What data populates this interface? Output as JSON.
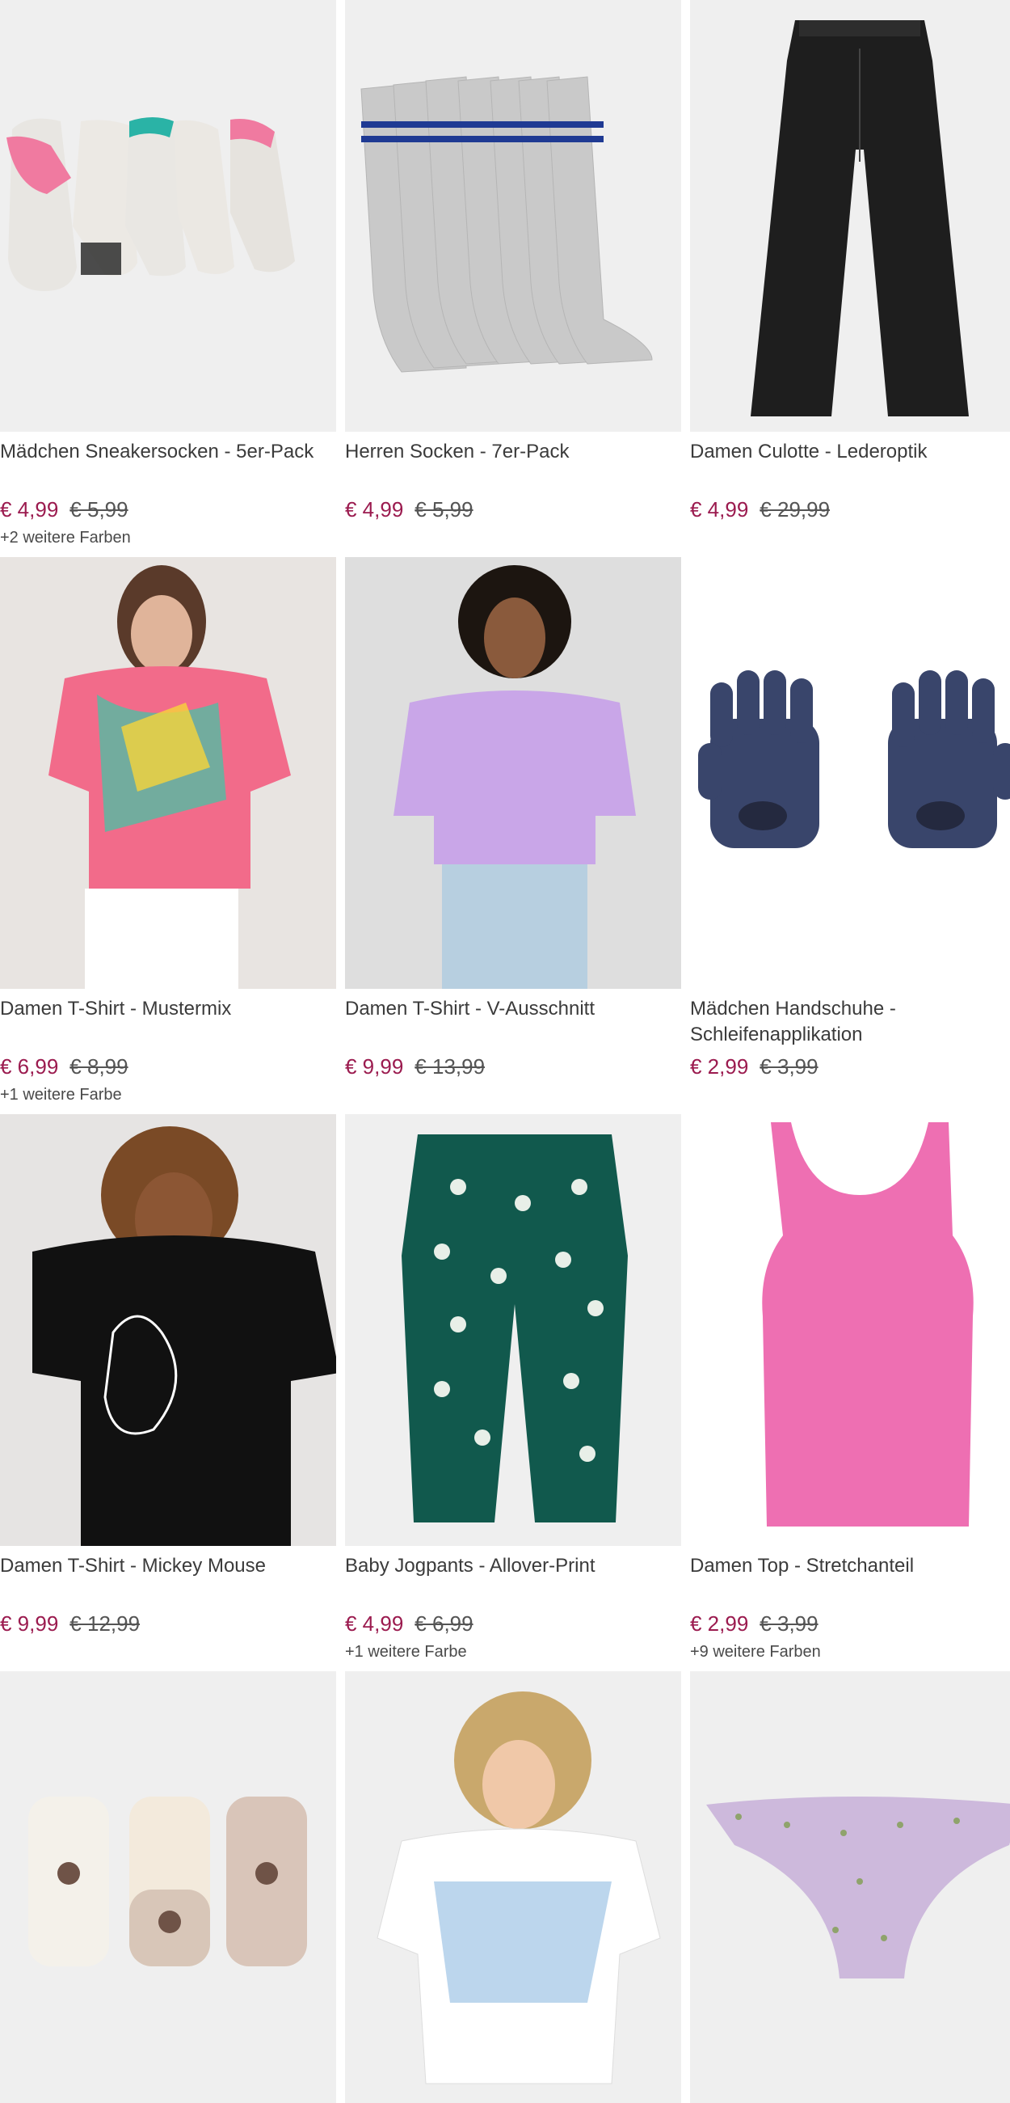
{
  "products": [
    {
      "title": "Mädchen Sneakersocken - 5er-Pack",
      "price": "€ 4,99",
      "old_price": "€ 5,99",
      "colors": "+2 weitere Farben"
    },
    {
      "title": "Herren Socken - 7er-Pack",
      "price": "€ 4,99",
      "old_price": "€ 5,99",
      "colors": ""
    },
    {
      "title": "Damen Culotte - Lederoptik",
      "price": "€ 4,99",
      "old_price": "€ 29,99",
      "colors": ""
    },
    {
      "title": "Damen T-Shirt - Mustermix",
      "price": "€ 6,99",
      "old_price": "€ 8,99",
      "colors": "+1 weitere Farbe"
    },
    {
      "title": "Damen T-Shirt - V-Ausschnitt",
      "price": "€ 9,99",
      "old_price": "€ 13,99",
      "colors": ""
    },
    {
      "title": "Mädchen Handschuhe - Schleifenapplikation",
      "price": "€ 2,99",
      "old_price": "€ 3,99",
      "colors": ""
    },
    {
      "title": "Damen T-Shirt - Mickey Mouse",
      "price": "€ 9,99",
      "old_price": "€ 12,99",
      "colors": ""
    },
    {
      "title": "Baby Jogpants - Allover-Print",
      "price": "€ 4,99",
      "old_price": "€ 6,99",
      "colors": "+1 weitere Farbe"
    },
    {
      "title": "Damen Top - Stretchanteil",
      "price": "€ 2,99",
      "old_price": "€ 3,99",
      "colors": "+9 weitere Farben"
    }
  ],
  "images": [
    {
      "icon": "sneaker-socks-image"
    },
    {
      "icon": "crew-socks-image"
    },
    {
      "icon": "leather-pants-image"
    },
    {
      "icon": "tshirt-pattern-image"
    },
    {
      "icon": "tshirt-vneck-image"
    },
    {
      "icon": "gloves-image"
    },
    {
      "icon": "mickey-tshirt-image"
    },
    {
      "icon": "jogpants-image"
    },
    {
      "icon": "tank-top-image"
    },
    {
      "icon": "baby-socks-image"
    },
    {
      "icon": "white-tshirt-image"
    },
    {
      "icon": "bikini-bottom-image"
    }
  ],
  "colors": {
    "price": "#9b1b4f",
    "text": "#3b3b3b",
    "image_bg": "#efefef"
  }
}
